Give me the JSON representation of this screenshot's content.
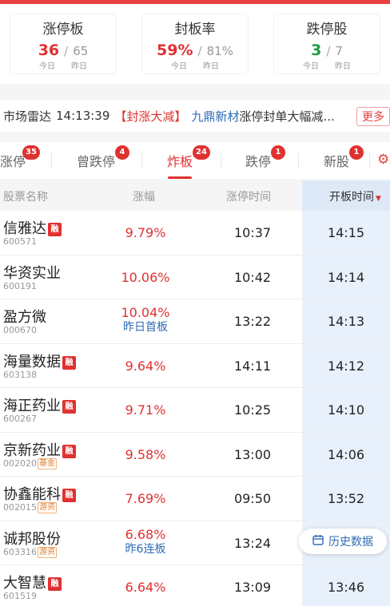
{
  "stats": [
    {
      "title": "涨停板",
      "today": "36",
      "yesterday": "65",
      "color": "red",
      "today_label": "今日",
      "yesterday_label": "昨日"
    },
    {
      "title": "封板率",
      "today": "59%",
      "yesterday": "81%",
      "color": "red",
      "today_label": "今日",
      "yesterday_label": "昨日"
    },
    {
      "title": "跌停股",
      "today": "3",
      "yesterday": "7",
      "color": "green",
      "today_label": "今日",
      "yesterday_label": "昨日"
    }
  ],
  "radar": {
    "label": "市场雷达",
    "time": "14:13:39",
    "tag": "【封涨大减】",
    "stock": "九鼎新材",
    "text": "涨停封单大幅减...",
    "more": "更多"
  },
  "tabs": [
    {
      "label": "涨停",
      "badge": "35",
      "active": false
    },
    {
      "label": "曾跌停",
      "badge": "4",
      "active": false
    },
    {
      "label": "炸板",
      "badge": "24",
      "active": true
    },
    {
      "label": "跌停",
      "badge": "1",
      "active": false
    },
    {
      "label": "新股",
      "badge": "1",
      "active": false
    }
  ],
  "table": {
    "headers": {
      "name": "股票名称",
      "pct": "涨幅",
      "zt_time": "涨停时间",
      "open_time": "开板时间"
    },
    "rong_label": "融",
    "rows": [
      {
        "name": "信雅达",
        "code": "600571",
        "rong": true,
        "tag": "",
        "pct": "9.79%",
        "note": "",
        "zt_time": "10:37",
        "open_time": "14:15"
      },
      {
        "name": "华资实业",
        "code": "600191",
        "rong": false,
        "tag": "",
        "pct": "10.06%",
        "note": "",
        "zt_time": "10:42",
        "open_time": "14:14"
      },
      {
        "name": "盈方微",
        "code": "000670",
        "rong": false,
        "tag": "",
        "pct": "10.04%",
        "note": "昨日首板",
        "zt_time": "13:22",
        "open_time": "14:13"
      },
      {
        "name": "海量数据",
        "code": "603138",
        "rong": true,
        "tag": "",
        "pct": "9.64%",
        "note": "",
        "zt_time": "14:11",
        "open_time": "14:12"
      },
      {
        "name": "海正药业",
        "code": "600267",
        "rong": true,
        "tag": "",
        "pct": "9.71%",
        "note": "",
        "zt_time": "10:25",
        "open_time": "14:10"
      },
      {
        "name": "京新药业",
        "code": "002020",
        "rong": true,
        "tag": "基金",
        "pct": "9.58%",
        "note": "",
        "zt_time": "13:00",
        "open_time": "14:06"
      },
      {
        "name": "协鑫能科",
        "code": "002015",
        "rong": true,
        "tag": "游资",
        "pct": "7.69%",
        "note": "",
        "zt_time": "09:50",
        "open_time": "13:52"
      },
      {
        "name": "诚邦股份",
        "code": "603316",
        "rong": false,
        "tag": "游资",
        "pct": "6.68%",
        "note": "昨6连板",
        "zt_time": "13:24",
        "open_time": ""
      },
      {
        "name": "大智慧",
        "code": "601519",
        "rong": true,
        "tag": "",
        "pct": "6.64%",
        "note": "",
        "zt_time": "13:09",
        "open_time": "13:46"
      }
    ]
  },
  "history_button": "历史数据"
}
